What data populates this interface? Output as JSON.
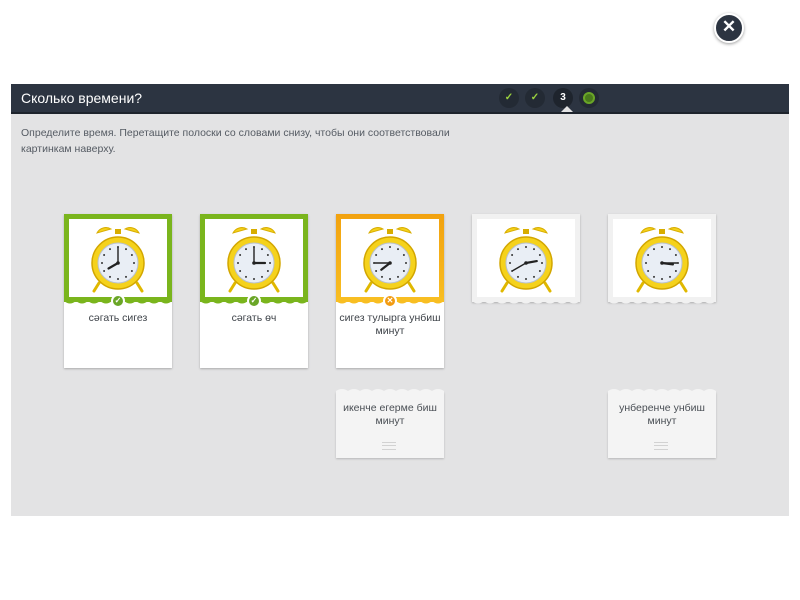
{
  "header": {
    "title": "Сколько времени?"
  },
  "steps": [
    {
      "label": "✓",
      "state": "done"
    },
    {
      "label": "✓",
      "state": "done"
    },
    {
      "label": "3",
      "state": "current"
    },
    {
      "label": "",
      "state": "next"
    }
  ],
  "close": {
    "icon": "close-icon",
    "symbol": "✕"
  },
  "instruction": "Определите время. Перетащите полоски со словами снизу, чтобы они соответствовали картинкам наверху.",
  "cards": [
    {
      "state": "correct",
      "label": "сәгать сигез",
      "badge": "✓",
      "clock": {
        "hour": 8,
        "minute": 0
      }
    },
    {
      "state": "correct",
      "label": "сәгать өч",
      "badge": "✓",
      "clock": {
        "hour": 3,
        "minute": 0
      }
    },
    {
      "state": "wrong",
      "label": "сигез тулырга унбиш минут",
      "badge": "✕",
      "clock": {
        "hour": 7,
        "minute": 45
      }
    },
    {
      "state": "empty",
      "label": "",
      "badge": "",
      "clock": {
        "hour": 2,
        "minute": 40
      }
    },
    {
      "state": "empty",
      "label": "",
      "badge": "",
      "clock": {
        "hour": 3,
        "minute": 15
      }
    }
  ],
  "strips": [
    {
      "label": "икенче егерме биш минут"
    },
    {
      "label": "унберенче унбиш минут"
    }
  ],
  "colors": {
    "header": "#2c3441",
    "correct": "#7ab51d",
    "wrong": "#f6ad18",
    "bg": "#e3e3e4"
  }
}
